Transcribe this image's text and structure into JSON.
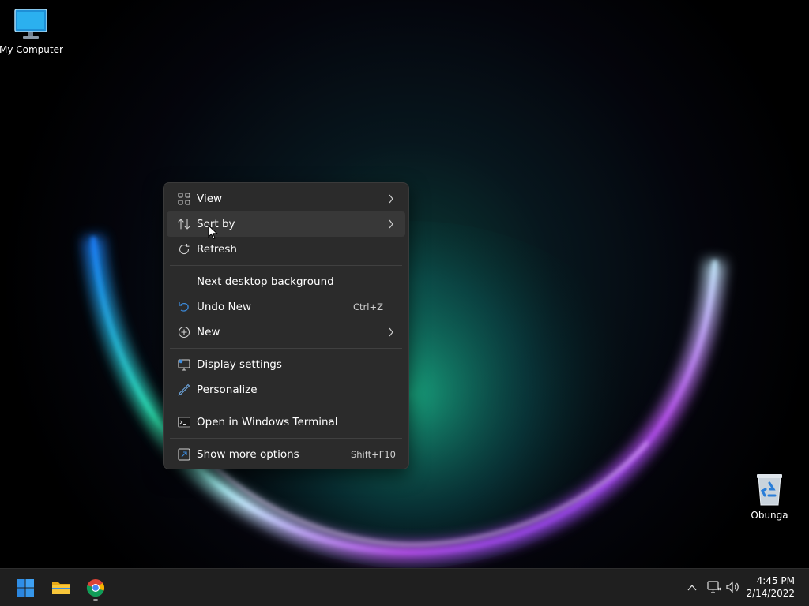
{
  "desktop": {
    "icons": [
      {
        "label": "My Computer",
        "icon": "monitor-icon"
      },
      {
        "label": "Obunga",
        "icon": "recycle-bin-icon"
      }
    ]
  },
  "context_menu": {
    "items": [
      {
        "label": "View",
        "icon": "grid-icon",
        "submenu": true
      },
      {
        "label": "Sort by",
        "icon": "sort-icon",
        "submenu": true
      },
      {
        "label": "Refresh",
        "icon": "refresh-icon"
      },
      {
        "label": "Next desktop background"
      },
      {
        "label": "Undo New",
        "icon": "undo-icon",
        "shortcut": "Ctrl+Z"
      },
      {
        "label": "New",
        "icon": "plus-circle-icon",
        "submenu": true
      },
      {
        "label": "Display settings",
        "icon": "display-icon"
      },
      {
        "label": "Personalize",
        "icon": "pen-icon"
      },
      {
        "label": "Open in Windows Terminal",
        "icon": "terminal-icon"
      },
      {
        "label": "Show more options",
        "icon": "expand-icon",
        "shortcut": "Shift+F10"
      }
    ]
  },
  "taskbar": {
    "apps": [
      "start-icon",
      "file-explorer-icon",
      "chrome-icon"
    ],
    "tray_icons": [
      "chevron-up-icon",
      "network-icon",
      "volume-icon"
    ],
    "clock": {
      "time": "4:45 PM",
      "date": "2/14/2022"
    }
  },
  "colors": {
    "menu_bg": "#2b2b2b",
    "taskbar_bg": "#1f1f1f",
    "accent_blue": "#3c8bdc"
  }
}
